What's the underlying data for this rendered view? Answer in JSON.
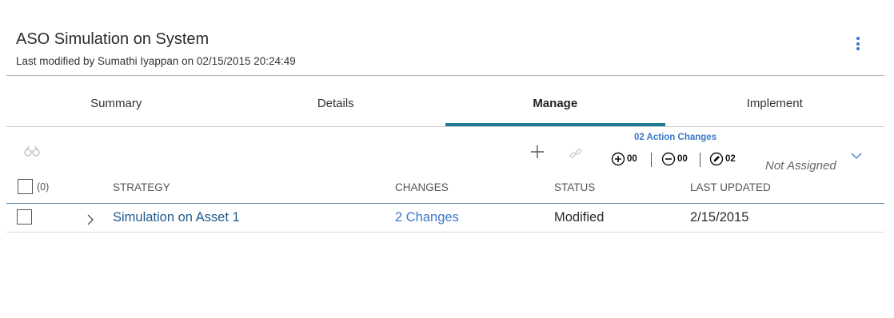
{
  "header": {
    "title": "ASO Simulation on System",
    "subtitle": "Last modified by Sumathi Iyappan on 02/15/2015 20:24:49"
  },
  "tabs": [
    {
      "label": "Summary",
      "active": false
    },
    {
      "label": "Details",
      "active": false
    },
    {
      "label": "Manage",
      "active": true
    },
    {
      "label": "Implement",
      "active": false
    }
  ],
  "toolbar": {
    "action_changes": "02 Action Changes",
    "added_count": "00",
    "removed_count": "00",
    "modified_count": "02",
    "assignee": "Not Assigned",
    "icons": [
      "binoculars-icon",
      "plus-icon",
      "link-icon",
      "plus-circle-icon",
      "minus-circle-icon",
      "pencil-circle-icon",
      "chevron-down-icon"
    ]
  },
  "grid": {
    "select_count": "(0)",
    "columns": [
      "STRATEGY",
      "CHANGES",
      "STATUS",
      "LAST UPDATED"
    ],
    "rows": [
      {
        "strategy": "Simulation on Asset 1",
        "changes": "2 Changes",
        "status": "Modified",
        "last_updated": "2/15/2015"
      }
    ]
  },
  "colors": {
    "accent": "#1d7c95",
    "link": "#1f5b8f",
    "highlight": "#3a78c9"
  }
}
